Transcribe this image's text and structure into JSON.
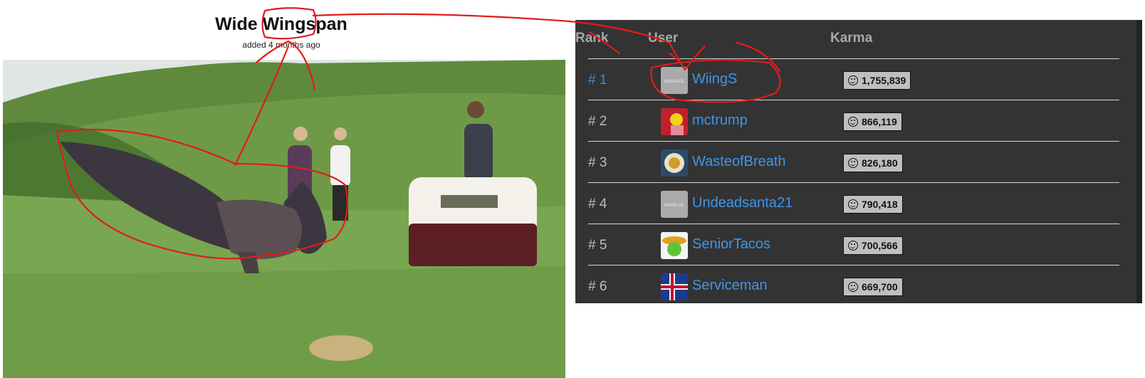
{
  "post": {
    "title": "Wide Wingspan",
    "meta": "added 4 months ago"
  },
  "leaderboard": {
    "headers": {
      "rank": "Rank",
      "user": "User",
      "karma": "Karma"
    },
    "rows": [
      {
        "rank": "# 1",
        "user": "WiingS",
        "karma": "1,755,839",
        "avatar": "hugelol-logo"
      },
      {
        "rank": "# 2",
        "user": "mctrump",
        "karma": "866,119",
        "avatar": "cartoon-avatar"
      },
      {
        "rank": "# 3",
        "user": "WasteofBreath",
        "karma": "826,180",
        "avatar": "badge-avatar"
      },
      {
        "rank": "# 4",
        "user": "Undeadsanta21",
        "karma": "790,418",
        "avatar": "hugelol-logo"
      },
      {
        "rank": "# 5",
        "user": "SeniorTacos",
        "karma": "700,566",
        "avatar": "sombrero-avatar"
      },
      {
        "rank": "# 6",
        "user": "Serviceman",
        "karma": "669,700",
        "avatar": "flag-avatar"
      }
    ],
    "avatar_text": "HUGELOL"
  },
  "colors": {
    "link": "#3f96e6",
    "board_bg": "#333333",
    "annotation": "#e31b1b"
  }
}
